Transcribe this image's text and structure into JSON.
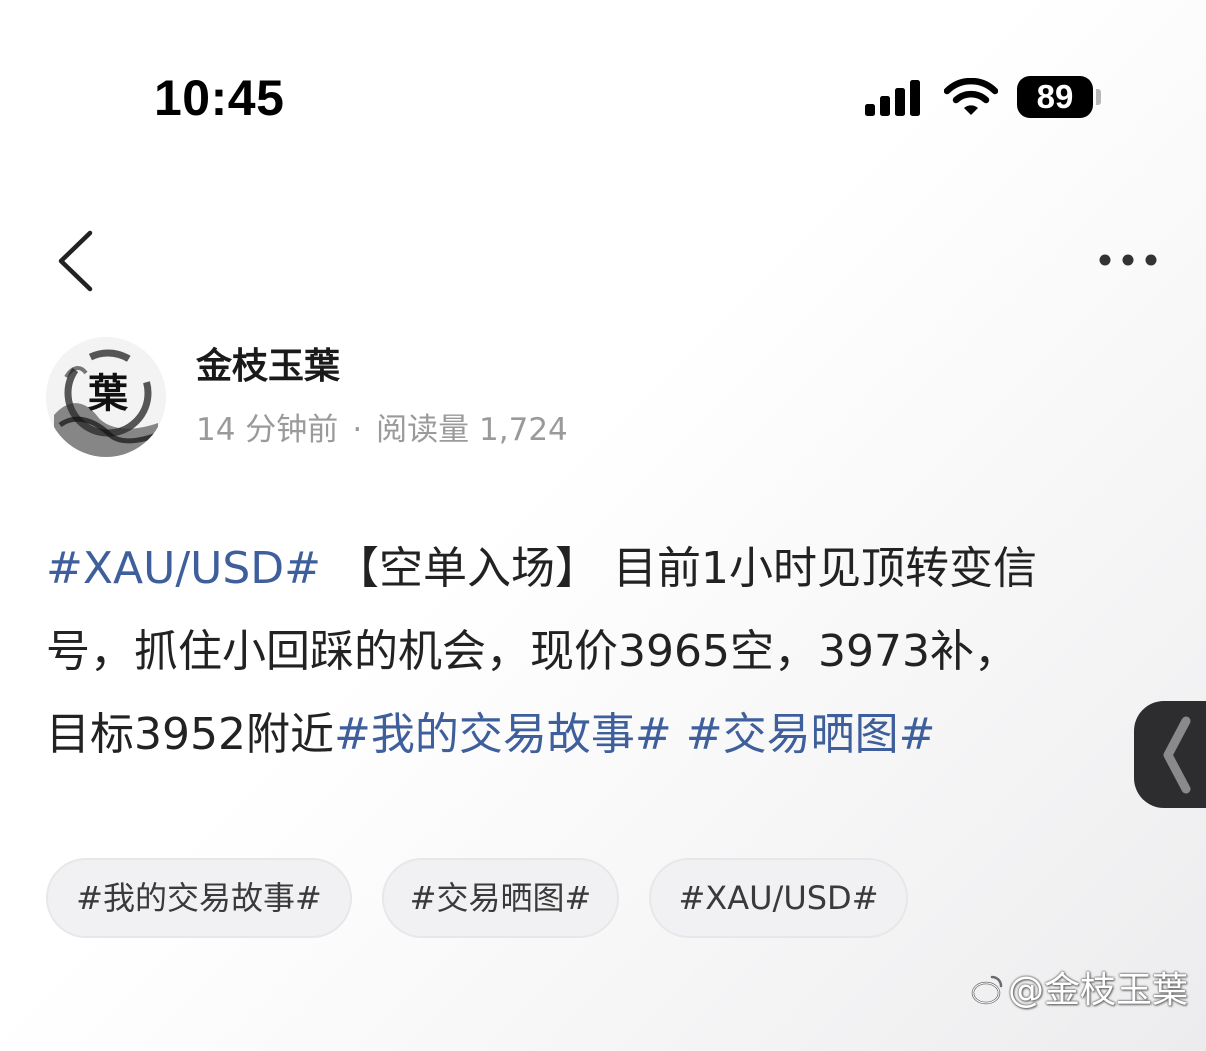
{
  "status_bar": {
    "time": "10:45",
    "battery": "89",
    "icons": [
      "signal-icon",
      "wifi-icon",
      "battery-icon"
    ]
  },
  "nav": {
    "back_icon": "chevron-left-icon",
    "more_icon": "more-horizontal-icon"
  },
  "author": {
    "name": "金枝玉葉",
    "avatar_char": "葉",
    "time_ago": "14 分钟前",
    "separator": "·",
    "views_label": "阅读量 1,724"
  },
  "post": {
    "line1": {
      "hashtag": "#XAU/USD#",
      "text": " 【空单入场】 目前1小时见顶转变信"
    },
    "line2": {
      "text": "号，抓住小回踩的机会，现价3965空，3973补，"
    },
    "line3": {
      "text": "目标3952附近",
      "hashtag1": "#我的交易故事#",
      "space": " ",
      "hashtag2": "#交易晒图#"
    }
  },
  "topics": [
    "#我的交易故事#",
    "#交易晒图#",
    "#XAU/USD#"
  ],
  "side_tab": {
    "icon": "chevron-left-icon"
  },
  "watermark": {
    "text": "@金枝玉葉",
    "icon": "weibo-logo-icon"
  },
  "colors": {
    "hashtag": "#3e5f9c",
    "meta": "#9a9a9a",
    "chip_bg": "#f1f1f3",
    "side_tab": "#2d2d2f"
  }
}
